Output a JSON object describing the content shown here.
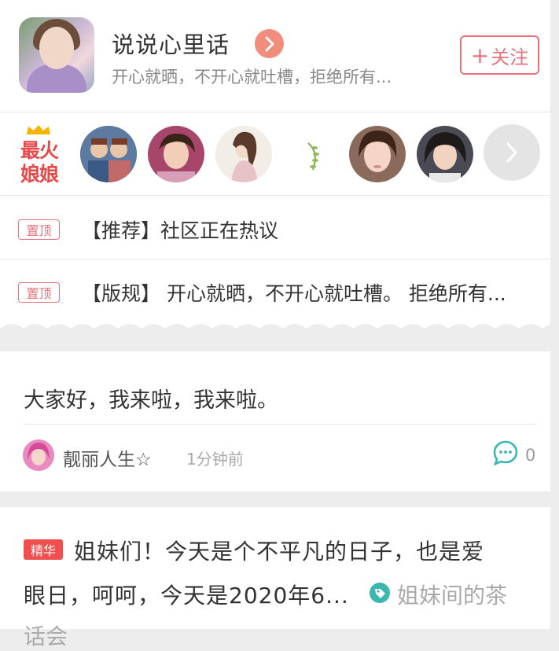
{
  "group": {
    "title": "说说心里话",
    "subtitle": "开心就晒，不开心就吐槽，拒绝所有...",
    "follow_label": "关注",
    "follow_plus": "+"
  },
  "members": {
    "hot_badge_line1": "最火",
    "hot_badge_line2": "娘娘"
  },
  "pinned": [
    {
      "tag": "置顶",
      "text": "【推荐】社区正在热议"
    },
    {
      "tag": "置顶",
      "text": "【版规】 开心就晒，不开心就吐槽。 拒绝所有..."
    }
  ],
  "post1": {
    "content": "大家好，我来啦，我来啦。",
    "author": "靓丽人生☆",
    "time": "1分钟前",
    "comments": "0"
  },
  "post2": {
    "tag": "精华",
    "line1": "姐妹们！今天是个不平凡的日子，也是爱",
    "line2": "眼日，呵呵，今天是2020年6...",
    "topic": "姐妹间的茶",
    "topic_cont": "话会"
  },
  "colors": {
    "accent": "#e8737a",
    "elite": "#ef4f4f",
    "teal": "#3bb6b0"
  }
}
